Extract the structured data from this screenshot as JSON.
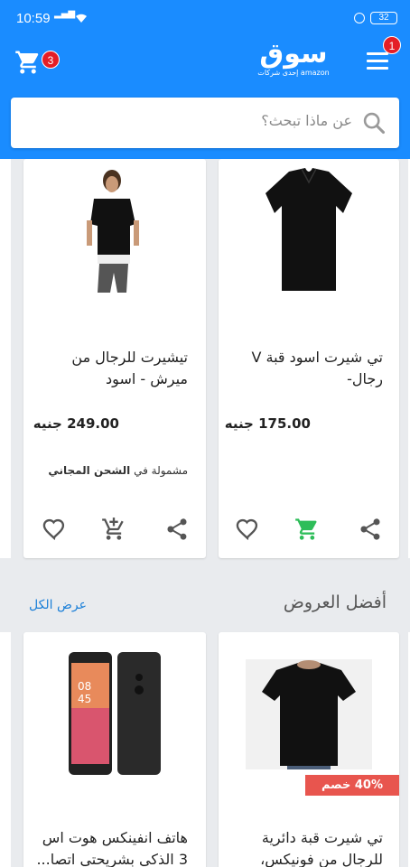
{
  "status_bar": {
    "time": "10:59",
    "battery": "32"
  },
  "header": {
    "cart_count": "3",
    "menu_count": "1",
    "logo_text": "سوق",
    "logo_subtext": "إحدى شركات amazon"
  },
  "search": {
    "placeholder": "عن ماذا تبحث؟"
  },
  "products_row1": [
    {
      "title": "تي شيرت اسود قبة V رجال-",
      "price": "175.00 جنيه",
      "shipping": ""
    },
    {
      "title": "تيشيرت للرجال من ميرش - اسود",
      "price": "249.00 جنيه",
      "shipping_prefix": "مشمولة في",
      "shipping_bold": "الشحن المجاني"
    }
  ],
  "deals_section": {
    "title": "أفضل العروض",
    "view_all": "عرض الكل"
  },
  "products_row2": [
    {
      "title": "تي شيرت قبة دائرية للرجال من فونيكس، اس...",
      "discount": "40% خصم"
    },
    {
      "title": "هاتف انفينكس هوت اس 3 الذكي بشريحتي اتصا..."
    }
  ],
  "colors": {
    "brand_blue": "#1a8cff",
    "badge_red": "#e41e26",
    "cart_green": "#2ebd59",
    "discount_red": "#e8554e"
  }
}
